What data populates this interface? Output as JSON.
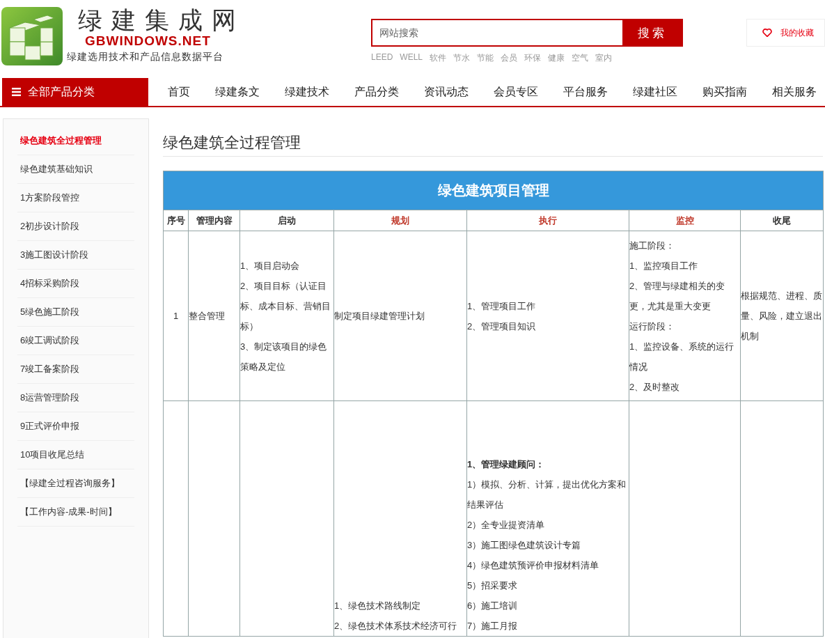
{
  "header": {
    "site_name": "绿建集成网",
    "domain": "GBWINDOWS.NET",
    "tagline": "绿建选用技术和产品信息数据平台",
    "search": {
      "placeholder": "网站搜索",
      "button": "搜索"
    },
    "hot_words": [
      "LEED",
      "WELL",
      "软件",
      "节水",
      "节能",
      "会员",
      "环保",
      "健康",
      "空气",
      "室内"
    ],
    "favorites": "我的收藏"
  },
  "nav": {
    "category_button": "全部产品分类",
    "items": [
      "首页",
      "绿建条文",
      "绿建技术",
      "产品分类",
      "资讯动态",
      "会员专区",
      "平台服务",
      "绿建社区",
      "购买指南",
      "相关服务"
    ]
  },
  "sidebar": {
    "items": [
      {
        "label": "绿色建筑全过程管理",
        "selected": true
      },
      {
        "label": "绿色建筑基础知识",
        "selected": false
      },
      {
        "label": "1方案阶段管控",
        "selected": false
      },
      {
        "label": "2初步设计阶段",
        "selected": false
      },
      {
        "label": "3施工图设计阶段",
        "selected": false
      },
      {
        "label": "4招标采购阶段",
        "selected": false
      },
      {
        "label": "5绿色施工阶段",
        "selected": false
      },
      {
        "label": "6竣工调试阶段",
        "selected": false
      },
      {
        "label": "7竣工备案阶段",
        "selected": false
      },
      {
        "label": "8运营管理阶段",
        "selected": false
      },
      {
        "label": "9正式评价申报",
        "selected": false
      },
      {
        "label": "10项目收尾总结",
        "selected": false
      },
      {
        "label": "【绿建全过程咨询服务】",
        "selected": false
      },
      {
        "label": "【工作内容-成果-时间】",
        "selected": false
      }
    ]
  },
  "page_title": "绿色建筑全过程管理",
  "table": {
    "title": "绿色建筑项目管理",
    "columns": [
      {
        "label": "序号",
        "highlighted": false
      },
      {
        "label": "管理内容",
        "highlighted": false
      },
      {
        "label": "启动",
        "highlighted": false
      },
      {
        "label": "规划",
        "highlighted": true
      },
      {
        "label": "执行",
        "highlighted": true
      },
      {
        "label": "监控",
        "highlighted": true
      },
      {
        "label": "收尾",
        "highlighted": false
      }
    ],
    "rows": [
      {
        "cells": [
          {
            "lines": [
              "1"
            ]
          },
          {
            "lines": [
              "整合管理"
            ]
          },
          {
            "lines": [
              "1、项目启动会",
              "2、项目目标（认证目标、成本目标、营销目标）",
              "3、制定该项目的绿色策略及定位"
            ]
          },
          {
            "lines": [
              "制定项目绿建管理计划"
            ]
          },
          {
            "lines": [
              "1、管理项目工作",
              "2、管理项目知识"
            ]
          },
          {
            "lines": [
              "施工阶段：",
              "1、监控项目工作",
              "2、管理与绿建相关的变更，尤其是重大变更",
              "运行阶段：",
              "1、监控设备、系统的运行情况",
              "2、及时整改"
            ]
          },
          {
            "lines": [
              "根据规范、进程、质量、风险，建立退出机制"
            ]
          }
        ]
      },
      {
        "cells": [
          {},
          {},
          {},
          {
            "lines": [
              "1、绿色技术路线制定",
              "2、绿色技术体系技术经济可行"
            ]
          },
          {
            "lines": [
              "**1、管理绿建顾问：**",
              "1）模拟、分析、计算，提出优化方案和结果评估",
              "2）全专业提资清单",
              "3）施工图绿色建筑设计专篇",
              "4）绿色建筑预评价申报材料清单",
              "5）招采要求",
              "6）施工培训",
              "7）施工月报"
            ]
          },
          {},
          {}
        ]
      }
    ]
  }
}
